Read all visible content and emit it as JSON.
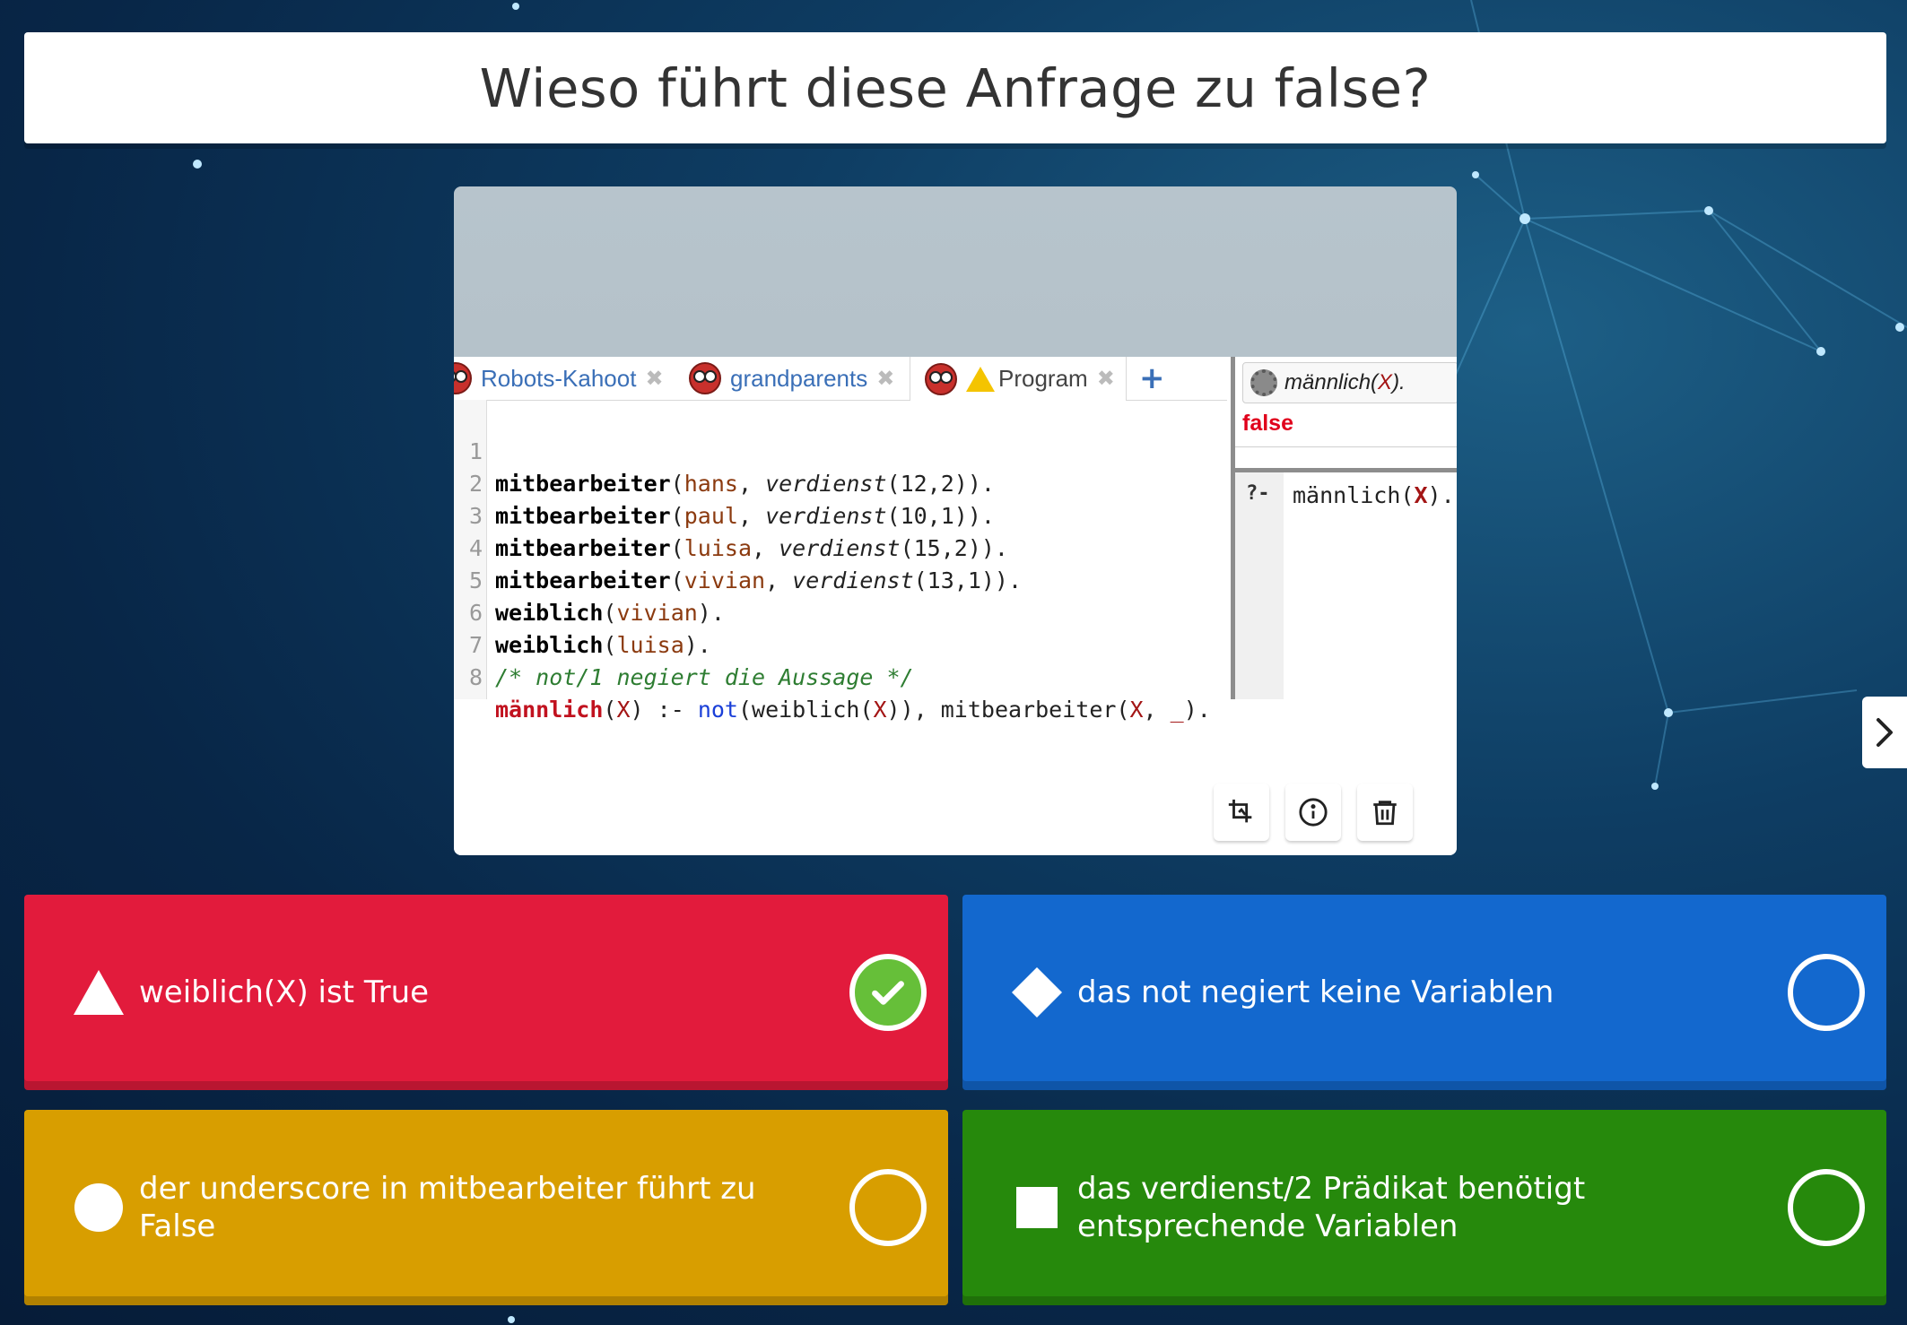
{
  "question": {
    "title": "Wieso führt diese Anfrage zu false?"
  },
  "editor": {
    "tabs": [
      {
        "label": "Robots-Kahoot",
        "close": "✖"
      },
      {
        "label": "grandparents",
        "close": "✖"
      },
      {
        "label": "Program",
        "close": "✖"
      }
    ],
    "new_tab": "+",
    "line_numbers": [
      "1",
      "2",
      "3",
      "4",
      "5",
      "6",
      "7",
      "8"
    ],
    "lines": [
      {
        "a": "mitbearbeiter",
        "b": "(",
        "c": "hans",
        "d": ", ",
        "e": "verdienst",
        "f": "(12,2))."
      },
      {
        "a": "mitbearbeiter",
        "b": "(",
        "c": "paul",
        "d": ", ",
        "e": "verdienst",
        "f": "(10,1))."
      },
      {
        "a": "mitbearbeiter",
        "b": "(",
        "c": "luisa",
        "d": ", ",
        "e": "verdienst",
        "f": "(15,2))."
      },
      {
        "a": "mitbearbeiter",
        "b": "(",
        "c": "vivian",
        "d": ", ",
        "e": "verdienst",
        "f": "(13,1))."
      },
      {
        "a": "weiblich",
        "b": "(",
        "c": "vivian",
        "d": ").",
        "e": "",
        "f": ""
      },
      {
        "a": "weiblich",
        "b": "(",
        "c": "luisa",
        "d": ").",
        "e": "",
        "f": ""
      }
    ],
    "comment_line": "/* not/1 negiert die Aussage */",
    "rule_line": {
      "head": "männlich",
      "p1": "(",
      "v1": "X",
      "p2": ") :- ",
      "not": "not",
      "p3": "(weiblich(",
      "v2": "X",
      "p4": ")), mitbearbeiter(",
      "v3": "X",
      "p5": ", ",
      "v4": "_",
      "p6": ")."
    }
  },
  "query_pane": {
    "query_head": "männlich(",
    "query_var": "X",
    "query_tail": ").",
    "result": "false",
    "prompt": "?-",
    "input_head": "männlich(",
    "input_var": "X",
    "input_tail": ")."
  },
  "answers": [
    {
      "text": "weiblich(X) ist True",
      "color": "#e21b3c",
      "shape": "triangle-icon",
      "state": "correct"
    },
    {
      "text": "das not negiert keine Variablen",
      "color": "#1368ce",
      "shape": "diamond-icon",
      "state": "unselected"
    },
    {
      "text": "der underscore in mitbearbeiter führt zu False",
      "color": "#d89e00",
      "shape": "circle-icon",
      "state": "unselected"
    },
    {
      "text": "das verdienst/2 Prädikat benötigt entsprechende Variablen",
      "color": "#26890c",
      "shape": "square-icon",
      "state": "unselected"
    }
  ],
  "colors": {
    "correct_badge": "#66bf39"
  }
}
